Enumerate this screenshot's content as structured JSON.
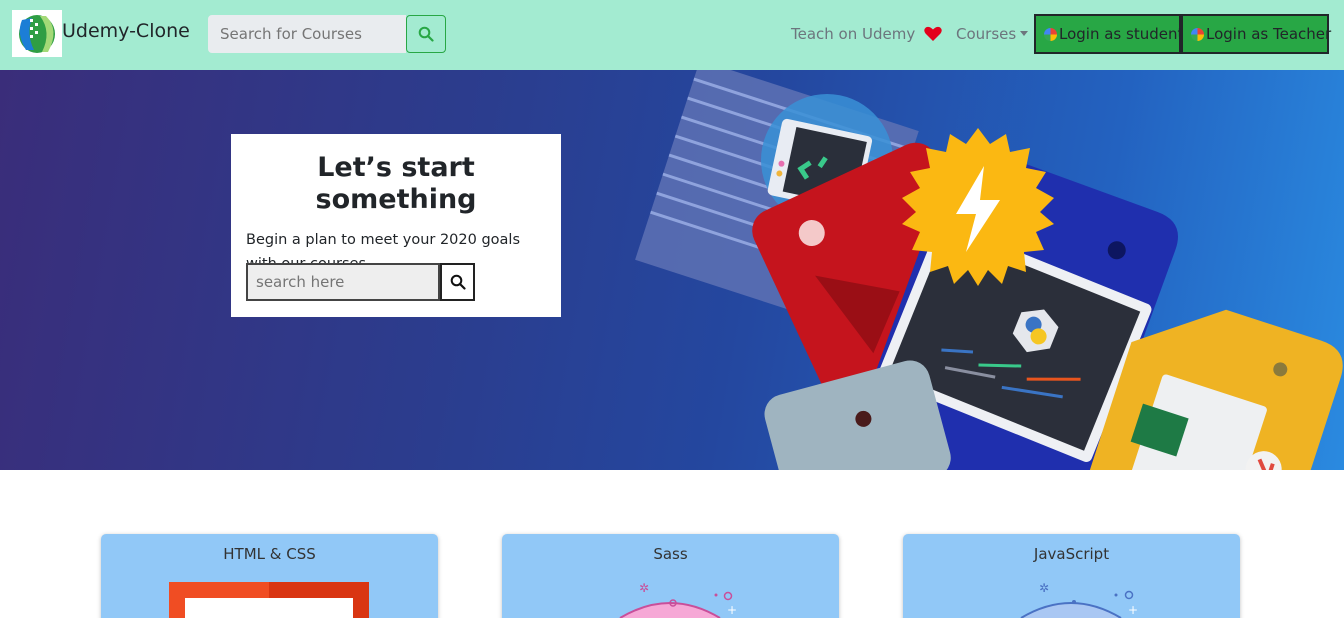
{
  "navbar": {
    "brand": "Udemy-Clone",
    "search_placeholder": "Search for Courses",
    "teach_link": "Teach on Udemy",
    "courses_menu": "Courses",
    "login_student": "Login as student",
    "login_teacher": "Login as Teacher"
  },
  "hero": {
    "title": "Let’s start something",
    "text": "Begin a plan to meet your 2020 goals with our courses",
    "search_placeholder": "search here"
  },
  "courses": [
    {
      "title": "HTML & CSS"
    },
    {
      "title": "Sass"
    },
    {
      "title": "JavaScript"
    }
  ],
  "colors": {
    "navbar_bg": "#a3ebd1",
    "button_green": "#28a745",
    "card_bg": "#91c8f7",
    "heart": "#e3001b"
  },
  "icons": {
    "search": "search-icon",
    "heart": "heart-icon",
    "caret": "caret-down-icon",
    "google": "google-icon"
  }
}
